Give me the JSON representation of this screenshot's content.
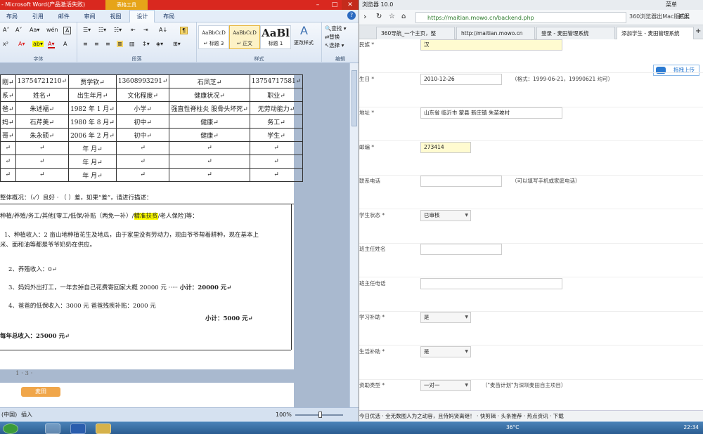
{
  "word": {
    "title": "- Microsoft Word(产品激活失败)",
    "context_tab": "表格工具",
    "tabs": [
      "布局",
      "引用",
      "邮件",
      "审阅",
      "视图",
      "设计",
      "布局"
    ],
    "ribbon": {
      "font_group": "字体",
      "para_group": "段落",
      "style_group": "样式",
      "edit_group": "编辑",
      "font_buttons": [
        "A˄",
        "A˅",
        "Aa▾",
        "wén",
        "A"
      ],
      "styles": [
        {
          "preview": "AaBbCcD",
          "name": "↵ 标题 3"
        },
        {
          "preview": "AaBbCcD",
          "name": "↵ 正文"
        },
        {
          "preview": "AaBl",
          "name": "标题 1"
        }
      ],
      "change_style": "更改样式",
      "find": "查找 ▾",
      "replace": "替换",
      "select": "选择 ▾"
    },
    "table": {
      "top_row": [
        "刚↵",
        "13754721210↵",
        "贾学钦↵",
        "13608993291↵",
        "石凤芝↵",
        "13754717581↵"
      ],
      "header": [
        "系↵",
        "姓名↵",
        "出生年月↵",
        "文化程度↵",
        "健康状况↵",
        "职业↵"
      ],
      "rows": [
        [
          "爸↵",
          "朱述福↵",
          "1982 年 1 月↵",
          "小学↵",
          "强直性脊柱炎 股骨头坏死↵",
          "无劳动能力↵"
        ],
        [
          "妈↵",
          "石芹美↵",
          "1980 年 8 月↵",
          "初中↵",
          "健康↵",
          "务工↵"
        ],
        [
          "哥↵",
          "朱永硕↵",
          "2006 年 2 月↵",
          "初中↵",
          "健康↵",
          "学生↵"
        ],
        [
          "↵",
          "↵",
          "年    月↵",
          "↵",
          "↵",
          "↵"
        ],
        [
          "↵",
          "↵",
          "年    月↵",
          "↵",
          "↵",
          "↵"
        ],
        [
          "↵",
          "↵",
          "年    月↵",
          "↵",
          "↵",
          "↵"
        ]
      ]
    },
    "lines": {
      "health": "整体概况：（✓）良好 · （  ）差，如果“差”，请进行描述：",
      "income_type_pre": "种植/养殖/务工/其他[零工/低保/补贴（两免一补）/",
      "income_type_hl": "精准扶贫",
      "income_type_post": "/老人保险]等：",
      "item1a": "1、种植收入：2 亩山地种植花生及地瓜，由于家里没有劳动力，现由爷爷帮着耕种，现在基本上",
      "item1b": "米、面和油等都是爷爷奶奶在供应。",
      "item2": "2、养殖收入：0↵",
      "item3": "3、妈妈外出打工，一年去掉自己花费寄回家大概 20000 元 ·····",
      "item3_sub": "小计：20000 元↵",
      "item4": "4、爸爸的低保收入：3000 元   爸爸残疾补贴：2000 元",
      "item4_sub": "小计：5000 元↵",
      "total": "每年总收入：25000 元↵",
      "page_no": "1 · 3 ·"
    },
    "status": {
      "lang": "(中国)",
      "insert": "插入",
      "zoom": "100%"
    }
  },
  "browser": {
    "title": "浏览器 10.0",
    "top_right": "菜单",
    "url": "https://maitian.mowo.cn/backend.php",
    "search_hint": "360浏览器出Mac版啦！",
    "ext": "扩展",
    "tabs": [
      "360导航_一个主页，整",
      "http://maitian.mowo.cn",
      "登录 - 麦田管理系统",
      "添加学生 - 麦田管理系统"
    ],
    "upload": "拖拽上传",
    "form": [
      {
        "label": "民族 *",
        "value": "汉",
        "type": "input",
        "yellow": true
      },
      {
        "label": "生日 *",
        "value": "2010-12-26",
        "type": "input",
        "note": "（格式：1999-06-21，19990621 均可）"
      },
      {
        "label": "地址 *",
        "value": "山东省 临沂市 蒙县 新庄镇 朱苗坡村",
        "type": "input",
        "wide": true
      },
      {
        "label": "邮编 *",
        "value": "273414",
        "type": "input",
        "yellow": true
      },
      {
        "label": "联系电话",
        "value": "",
        "type": "input",
        "note": "（可以填写手机或家庭电话）"
      },
      {
        "label": "学生状态 *",
        "value": "已审核",
        "type": "select"
      },
      {
        "label": "班主任姓名",
        "value": "",
        "type": "input"
      },
      {
        "label": "班主任电话",
        "value": "",
        "type": "input",
        "wide": true
      },
      {
        "label": "学习补助 *",
        "value": "是",
        "type": "select"
      },
      {
        "label": "生活补助 *",
        "value": "是",
        "type": "select"
      },
      {
        "label": "资助类型 *",
        "value": "一对一",
        "type": "select",
        "note": "（\"麦苗计划\"为深圳麦田自主项目）"
      }
    ],
    "status": "今日优选 · 全无数图人为之动容，且侍妈贤离继！ · 快剪辑 · 头条推荐 · 热点资讯 · 下载"
  },
  "taskbar": {
    "temp": "36°C",
    "time": "22:34"
  }
}
